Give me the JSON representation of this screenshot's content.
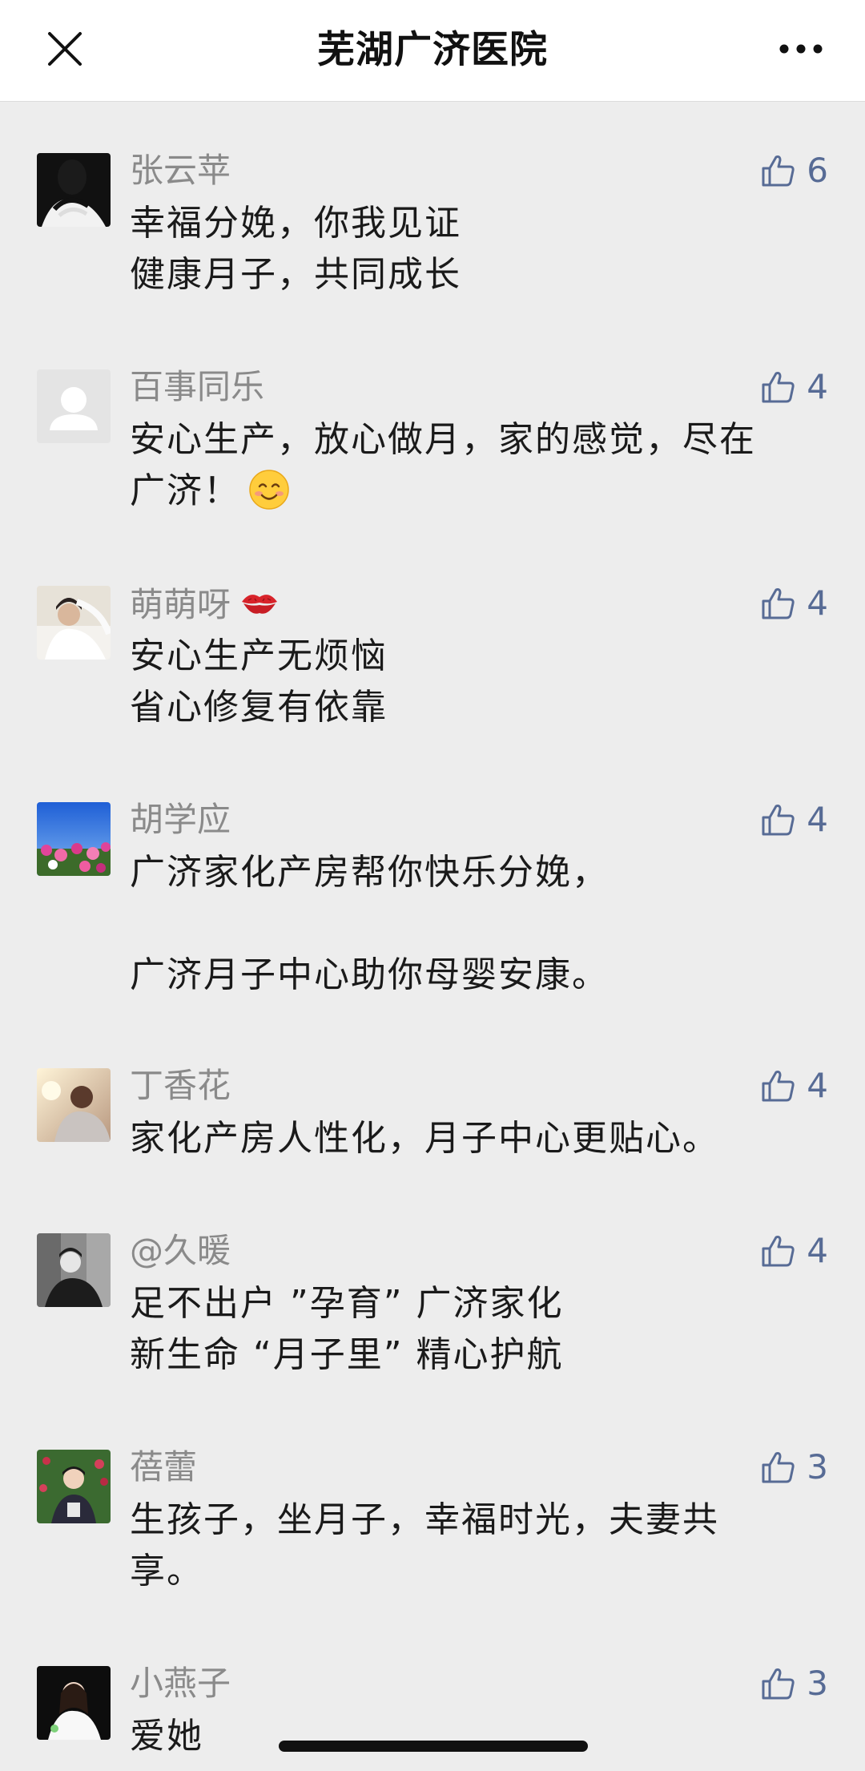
{
  "nav": {
    "title": "芜湖广济医院",
    "close_icon": "close-icon",
    "more_icon": "more-icon"
  },
  "comments": [
    {
      "nickname": "张云苹",
      "likes": "6",
      "lines": [
        "幸福分娩，你我见证",
        "健康月子，共同成长"
      ]
    },
    {
      "nickname": "百事同乐",
      "likes": "4",
      "lines": [
        "安心生产，放心做月，家的感觉，尽在",
        "广济！"
      ],
      "emoji": "smiling-face-emoji"
    },
    {
      "nickname": "萌萌呀",
      "nickname_emoji": "kiss-mark-emoji",
      "likes": "4",
      "lines": [
        "安心生产无烦恼",
        "省心修复有依靠"
      ]
    },
    {
      "nickname": "胡学应",
      "likes": "4",
      "lines": [
        "广济家化产房帮你快乐分娩，",
        "广济月子中心助你母婴安康。"
      ]
    },
    {
      "nickname": "丁香花",
      "likes": "4",
      "lines": [
        "家化产房人性化，月子中心更贴心。"
      ]
    },
    {
      "nickname": "@久暖",
      "likes": "4",
      "lines": [
        "足不出户 ”孕育” 广济家化",
        "新生命 “月子里” 精心护航"
      ]
    },
    {
      "nickname": "蓓蕾",
      "likes": "3",
      "lines": [
        "生孩子，坐月子，幸福时光，夫妻共",
        "享。"
      ]
    },
    {
      "nickname": "小燕子",
      "likes": "3",
      "lines": [
        "爱她"
      ]
    }
  ],
  "colors": {
    "background": "#ededed",
    "link_blue": "#576b95",
    "nickname_gray": "#8a8a8a"
  }
}
